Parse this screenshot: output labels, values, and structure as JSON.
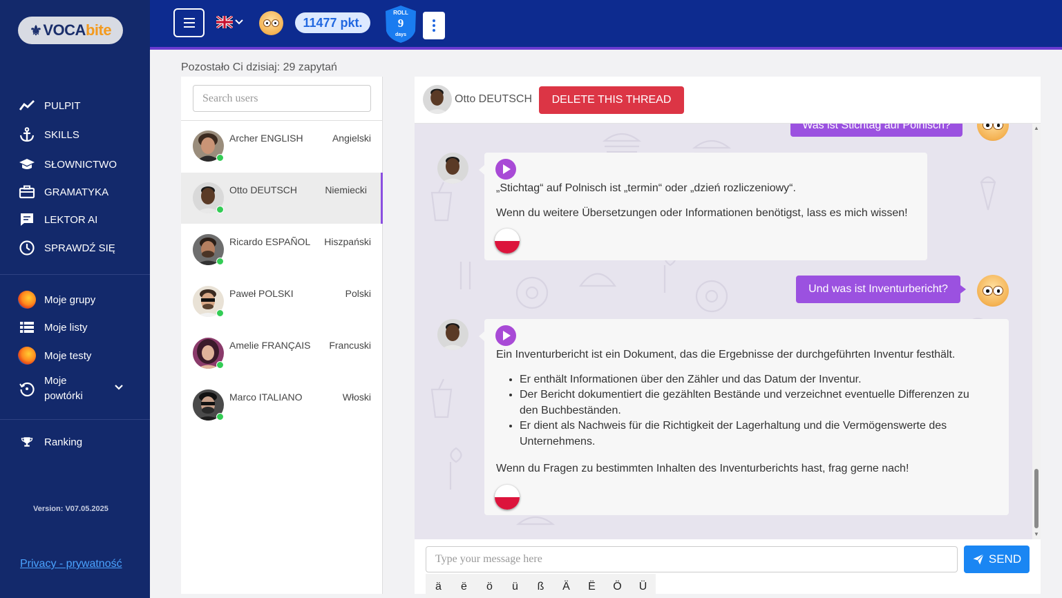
{
  "app": {
    "logo": {
      "prefix": "VOCA",
      "suffix": "bite"
    },
    "version": "Version: V07.05.2025",
    "privacy": "Privacy - prywatność"
  },
  "sidebar": {
    "main_items": [
      {
        "label": "PULPIT",
        "icon": "chart-line-icon"
      },
      {
        "label": "SKILLS",
        "icon": "anchor-icon"
      },
      {
        "label": "SŁOWNICTWO",
        "icon": "graduation-cap-icon"
      },
      {
        "label": "GRAMATYKA",
        "icon": "briefcase-icon"
      },
      {
        "label": "LEKTOR AI",
        "icon": "chat-icon"
      },
      {
        "label": "SPRAWDŹ SIĘ",
        "icon": "clock-icon"
      }
    ],
    "secondary_items": [
      {
        "label": "Moje grupy",
        "icon": "firefox-icon"
      },
      {
        "label": "Moje listy",
        "icon": "list-icon"
      },
      {
        "label": "Moje testy",
        "icon": "firefox-icon"
      },
      {
        "label_line1": "Moje",
        "label_line2": "powtórki",
        "icon": "history-icon"
      }
    ],
    "ranking": {
      "label": "Ranking",
      "icon": "trophy-icon"
    }
  },
  "topbar": {
    "points": "11477 pkt.",
    "roll": {
      "top": "ROLL",
      "number": "9",
      "bottom": "days"
    },
    "language": "en-gb"
  },
  "remaining_text": "Pozostało Ci dzisiaj: 29 zapytań",
  "users": {
    "search_placeholder": "Search users",
    "list": [
      {
        "name": "Archer ENGLISH",
        "language": "Angielski",
        "online": true
      },
      {
        "name": "Otto DEUTSCH",
        "language": "Niemiecki",
        "online": true,
        "active": true
      },
      {
        "name": "Ricardo ESPAÑOL",
        "language": "Hiszpański",
        "online": true
      },
      {
        "name": "Paweł POLSKI",
        "language": "Polski",
        "online": true
      },
      {
        "name": "Amelie FRANÇAIS",
        "language": "Francuski",
        "online": true
      },
      {
        "name": "Marco ITALIANO",
        "language": "Włoski",
        "online": true
      }
    ]
  },
  "chat": {
    "partner_name": "Otto DEUTSCH",
    "delete_label": "DELETE THIS THREAD",
    "messages": [
      {
        "from": "me",
        "text": "Was ist Stichtag auf Polnisch?"
      },
      {
        "from": "bot",
        "p1": "„Stichtag“ auf Polnisch ist „termin“ oder „dzień rozliczeniowy“.",
        "p2": "Wenn du weitere Übersetzungen oder Informationen benötigst, lass es mich wissen!"
      },
      {
        "from": "me",
        "text": "Und was ist Inventurbericht?"
      },
      {
        "from": "bot",
        "p1": "Ein Inventurbericht ist ein Dokument, das die Ergebnisse der durchgeführten Inventur festhält.",
        "bullets": [
          "Er enthält Informationen über den Zähler und das Datum der Inventur.",
          "Der Bericht dokumentiert die gezählten Bestände und verzeichnet eventuelle Differenzen zu den Buchbeständen.",
          "Er dient als Nachweis für die Richtigkeit der Lagerhaltung und die Vermögenswerte des Unternehmens."
        ],
        "p2": "Wenn du Fragen zu bestimmten Inhalten des Inventurberichts hast, frag gerne nach!"
      }
    ],
    "composer_placeholder": "Type your message here",
    "send_label": "SEND",
    "special_chars": [
      "ä",
      "ë",
      "ö",
      "ü",
      "ß",
      "Ä",
      "Ë",
      "Ö",
      "Ü"
    ]
  },
  "colors": {
    "sidebar_bg": "#13296b",
    "topbar_bg": "#0d2b8f",
    "accent_purple": "#9b51e0",
    "delete_red": "#dc3545",
    "send_blue": "#1a86f3",
    "points_text": "#2067e0"
  }
}
